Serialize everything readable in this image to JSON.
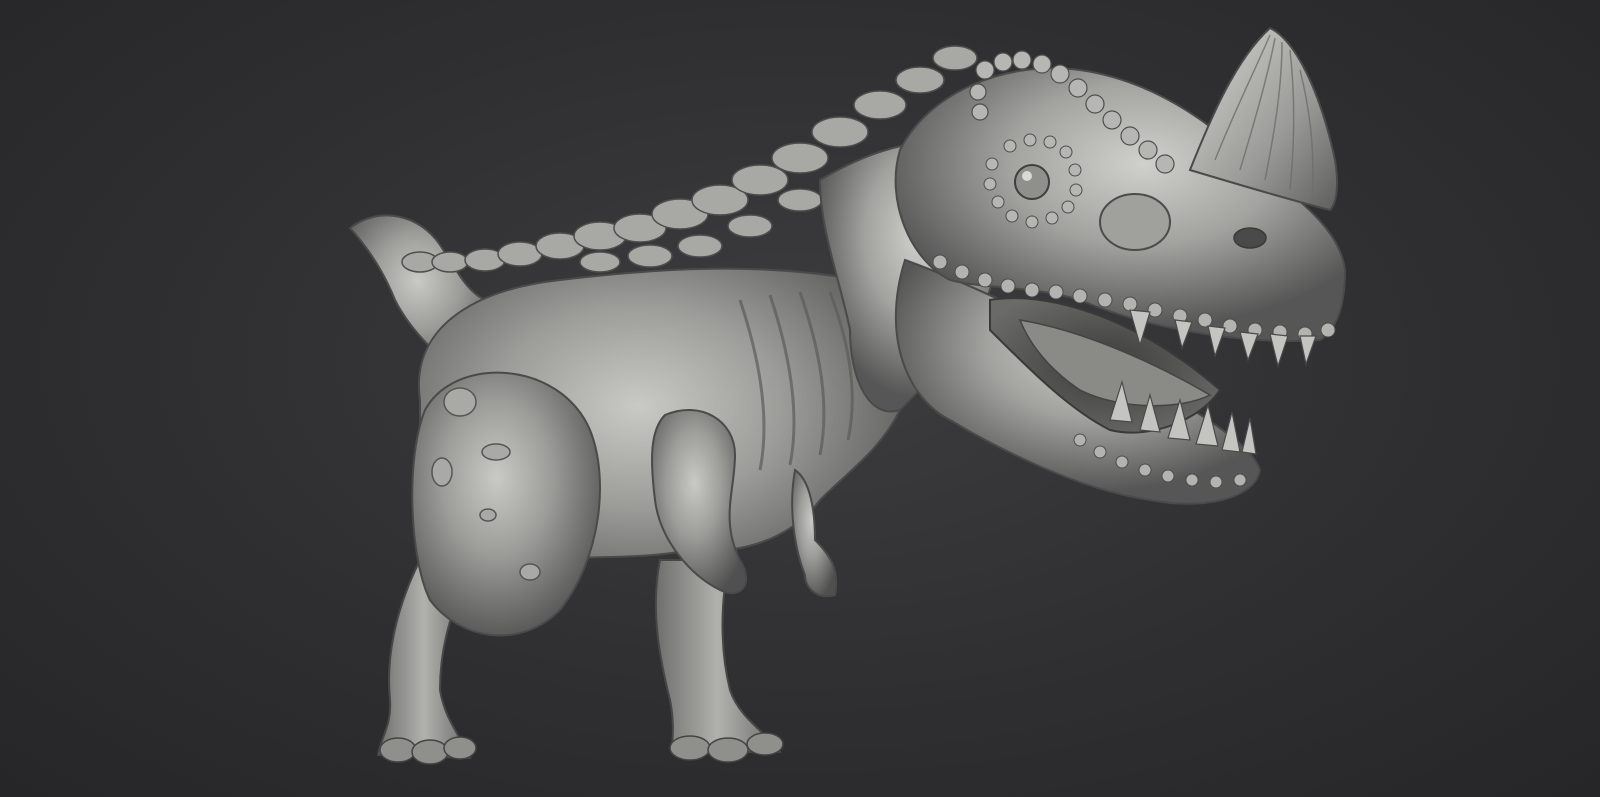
{
  "scene": {
    "background_color": "#303032",
    "material_color": "#9a9a98",
    "material_shadow": "#4a4a4a",
    "material_highlight": "#d6d6d2"
  },
  "subject": {
    "kind": "3D sculpt render",
    "icon": "dinosaur-sculpt"
  }
}
